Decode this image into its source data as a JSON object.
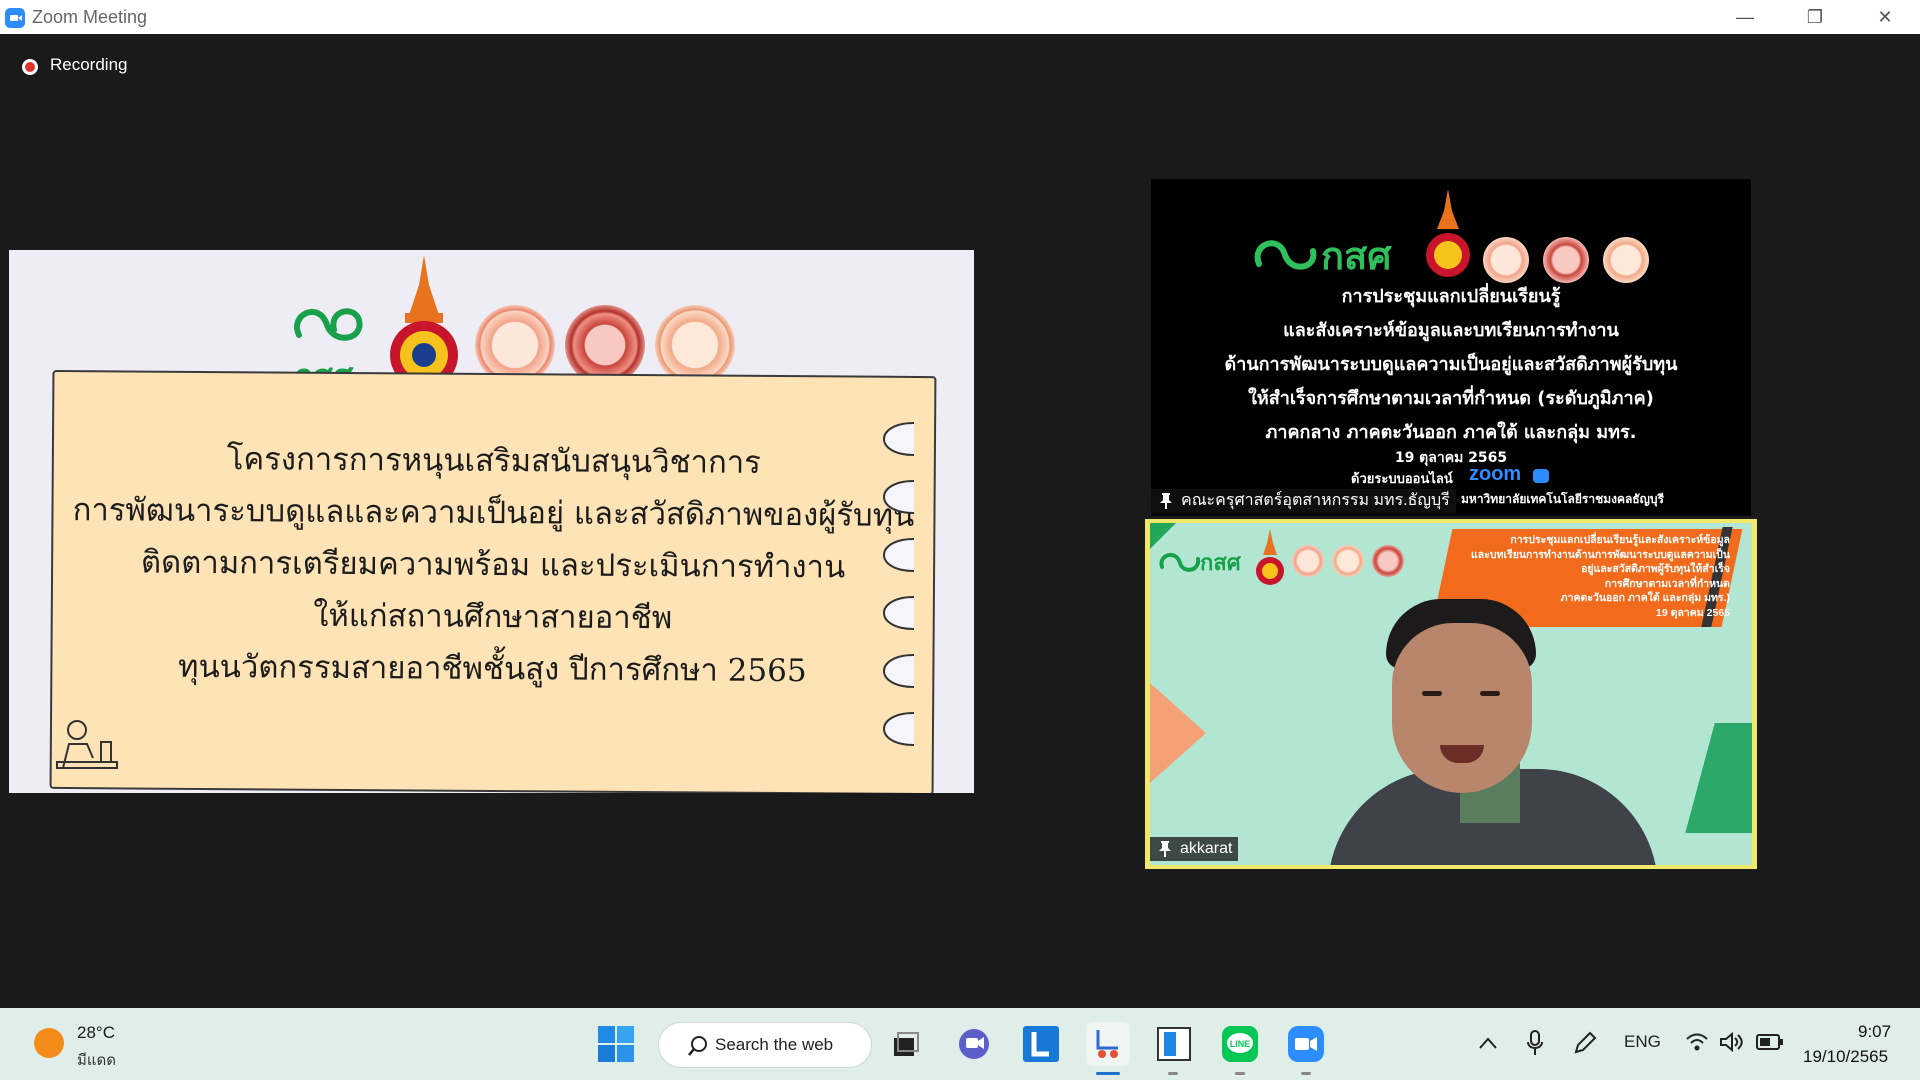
{
  "window": {
    "title": "Zoom Meeting",
    "minimize_glyph": "—",
    "maximize_glyph": "❐",
    "close_glyph": "✕"
  },
  "recording": {
    "label": "Recording",
    "dot_color": "#e0332d"
  },
  "shared_slide": {
    "logo_text": "กสศ",
    "lines": [
      "โครงการการหนุนเสริมสนับสนุนวิชาการ",
      "การพัฒนาระบบดูแลและความเป็นอยู่ และสวัสดิภาพของผู้รับทุน",
      "ติดตามการเตรียมความพร้อม และประเมินการทำงาน",
      "ให้แก่สถานศึกษาสายอาชีพ",
      "ทุนนวัตกรรมสายอาชีพชั้นสูง ปีการศึกษา 2565"
    ]
  },
  "participants": [
    {
      "name": "คณะครุศาสตร์อุตสาหกรรม มทร.ธัญบุรี",
      "background": {
        "logo_text": "กสศ",
        "lines": [
          "การประชุมแลกเปลี่ยนเรียนรู้",
          "และสังเคราะห์ข้อมูลและบทเรียนการทำงาน",
          "ด้านการพัฒนาระบบดูแลความเป็นอยู่และสวัสดิภาพผู้รับทุน",
          "ให้สำเร็จการศึกษาตามเวลาที่กำหนด (ระดับภูมิภาค)",
          "ภาคกลาง ภาคตะวันออก ภาคใต้ และกลุ่ม มทร."
        ],
        "date": "19 ตุลาคม 2565",
        "online_text": "ด้วยระบบออนไลน์",
        "zoom_text": "zoom",
        "host_text": "มหาวิทยาลัยเทคโนโลยีราชมงคลธัญบุรี"
      }
    },
    {
      "name": "akkarat",
      "background": {
        "logo_text": "กสศ",
        "banner_lines": [
          "การประชุมแลกเปลี่ยนเรียนรู้และสังเคราะห์ข้อมูล",
          "และบทเรียนการทำงานด้านการพัฒนาระบบดูแลความเป็น",
          "อยู่และสวัสดิภาพผู้รับทุนให้สำเร็จ",
          "การศึกษาตามเวลาที่กำหนด",
          "ภาคตะวันออก ภาคใต้ และกลุ่ม มทร.)",
          "19 ตุลาคม 2565"
        ]
      }
    }
  ],
  "taskbar": {
    "weather": {
      "temp": "28°C",
      "desc": "มีแดด"
    },
    "search_label": "Search the web",
    "tray": {
      "language": "ENG"
    },
    "clock": {
      "time": "9:07",
      "date": "19/10/2565"
    }
  },
  "colors": {
    "accent_green": "#18a04b",
    "zoom_blue": "#2d8cff",
    "tile_border": "#f0e86a"
  }
}
